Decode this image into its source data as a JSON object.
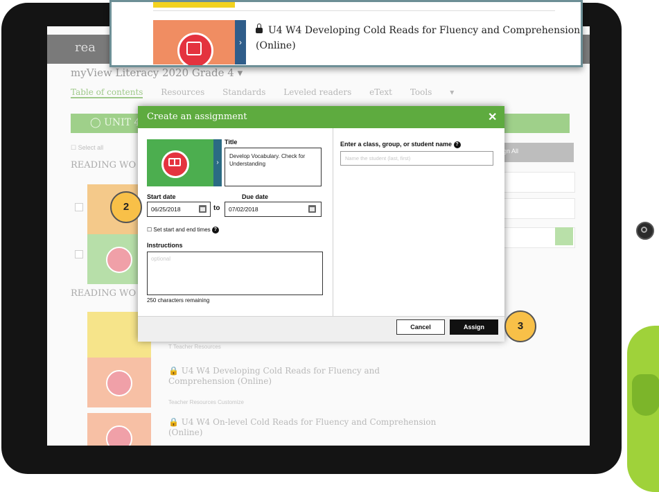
{
  "background": {
    "logo_text": "rea",
    "course_title": "myView Literacy 2020 Grade 4",
    "nav": [
      "Table of contents",
      "Resources",
      "Standards",
      "Leveled readers",
      "eText",
      "Tools"
    ],
    "unit_bar": "UNIT 4",
    "select_all": "Select all",
    "heading_1": "READING WO",
    "heading_2": "READING WO",
    "assign_all": "gn All",
    "rows": [
      {
        "title": "U4 W4 Developing Cold Reads for Fluency and Comprehension (Online)",
        "meta": "Teacher Resources   Customize"
      },
      {
        "title": "U4 W4 On-level Cold Reads for Fluency and Comprehension (Online)",
        "meta": ""
      }
    ],
    "teacher_resources": "Teacher Resources"
  },
  "top_panel": {
    "item_title": "U4 W4 Developing Cold Reads for Fluency and Comprehension (Online)",
    "accent_color": "#f08d62"
  },
  "modal": {
    "header_title": "Create an assignment",
    "close_glyph": "✕",
    "title_label": "Title",
    "title_value": "Develop Vocabulary. Check for Understanding",
    "start_date_label": "Start date",
    "start_date_value": "06/25/2018",
    "to_label": "to",
    "due_date_label": "Due date",
    "due_date_value": "07/02/2018",
    "set_times_label": "Set start and end times",
    "instructions_label": "Instructions",
    "instructions_placeholder": "optional",
    "chars_remaining": "250 characters remaining",
    "recipient_label": "Enter a class, group, or student name",
    "recipient_placeholder": "Name the student (last, first)",
    "cancel_label": "Cancel",
    "assign_label": "Assign",
    "header_color": "#5eab3f"
  },
  "callouts": {
    "step_2": "2",
    "step_3": "3"
  }
}
